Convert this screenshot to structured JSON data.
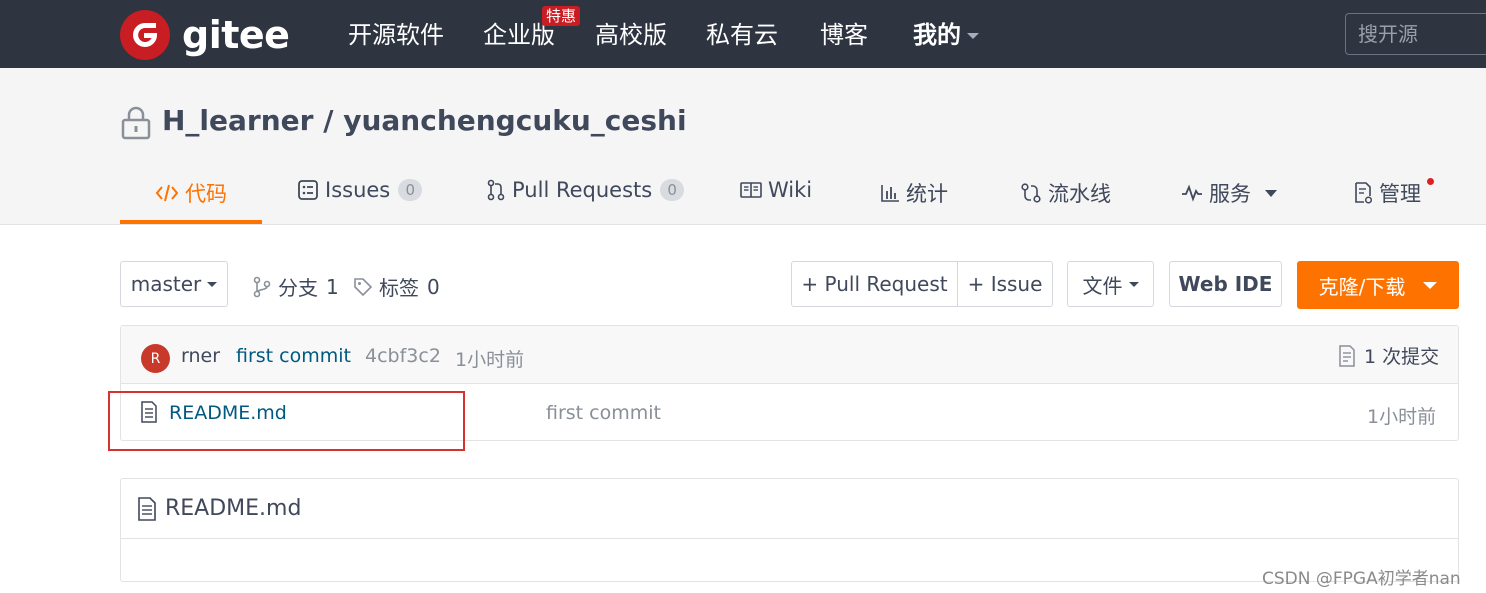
{
  "brand": {
    "name": "gitee",
    "color": "#c71d23"
  },
  "nav": {
    "items": [
      "开源软件",
      "企业版",
      "高校版",
      "私有云",
      "博客",
      "我的"
    ],
    "badge": "特惠",
    "search_placeholder": "搜开源"
  },
  "repo": {
    "owner": "H_learner",
    "separator": " / ",
    "name": "yuanchengcuku_ceshi",
    "private_icon": "lock-icon"
  },
  "tabs": [
    {
      "label": "代码",
      "icon": "code-icon",
      "active": true
    },
    {
      "label": "Issues",
      "icon": "issues-icon",
      "count": "0"
    },
    {
      "label": "Pull Requests",
      "icon": "pull-request-icon",
      "count": "0"
    },
    {
      "label": "Wiki",
      "icon": "wiki-icon"
    },
    {
      "label": "统计",
      "icon": "stats-icon"
    },
    {
      "label": "流水线",
      "icon": "pipeline-icon"
    },
    {
      "label": "服务",
      "icon": "service-icon"
    },
    {
      "label": "管理",
      "icon": "manage-icon"
    }
  ],
  "toolbar": {
    "branch": "master",
    "branches_label": "分支",
    "branches_count": "1",
    "tags_label": "标签",
    "tags_count": "0",
    "new_pr": "+ Pull Request",
    "new_issue": "+ Issue",
    "file_menu": "文件",
    "web_ide": "Web IDE",
    "clone": "克隆/下载"
  },
  "latest_commit": {
    "avatar_letter": "R",
    "author": "rner",
    "message": "first commit",
    "hash": "4cbf3c2",
    "time": "1小时前",
    "commits_count": "1 次提交"
  },
  "files": [
    {
      "name": "README.md",
      "message": "first commit",
      "time": "1小时前"
    }
  ],
  "readme": {
    "title": "README.md"
  },
  "watermark": "CSDN @FPGA初学者nan",
  "colors": {
    "accent": "#fe7300",
    "topbar": "#2e3440",
    "highlight_box": "#d9312e"
  }
}
